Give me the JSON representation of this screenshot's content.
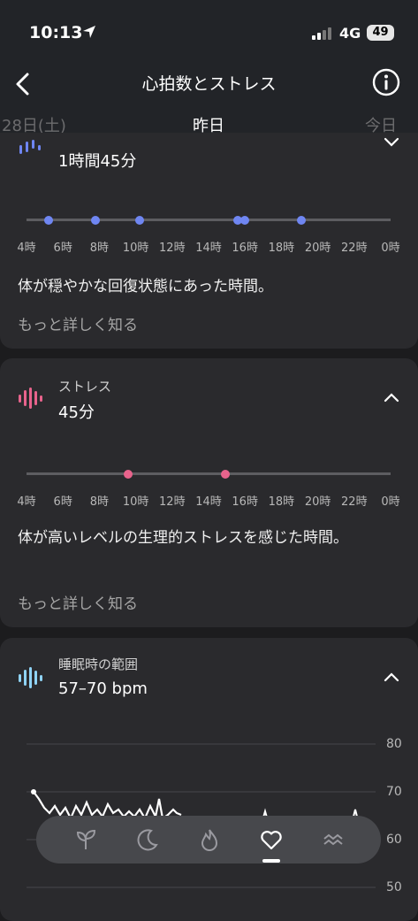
{
  "status_bar": {
    "time": "10:13",
    "network": "4G",
    "battery": "49"
  },
  "header": {
    "title": "心拍数とストレス"
  },
  "date_tabs": {
    "previous": "28日(土)",
    "current": "昨日",
    "next": "今日"
  },
  "time_axis": {
    "labels": [
      "4時",
      "6時",
      "8時",
      "10時",
      "12時",
      "14時",
      "16時",
      "18時",
      "20時",
      "22時",
      "0時"
    ]
  },
  "recovery": {
    "value": "1時間45分",
    "description": "体が穏やかな回復状態にあった時間。",
    "learn_more": "もっと詳しく知る",
    "color": "#6f86f2",
    "marks_hours": [
      5.2,
      7.8,
      10.2,
      15.6,
      16.0,
      19.1
    ]
  },
  "stress": {
    "label": "ストレス",
    "value": "45分",
    "description": "体が高いレベルの生理的ストレスを感じた時間。",
    "learn_more": "もっと詳しく知る",
    "color": "#e8638c",
    "marks_hours": [
      9.6,
      14.9
    ]
  },
  "sleep_range": {
    "label": "睡眠時の範囲",
    "value": "57–70 bpm",
    "color": "#8fd3f5",
    "y_ticks": [
      "80",
      "70",
      "60",
      "50"
    ]
  },
  "bottom_nav": {
    "items": [
      "sprout",
      "moon",
      "flame",
      "heart",
      "waves"
    ],
    "active": "heart"
  }
}
